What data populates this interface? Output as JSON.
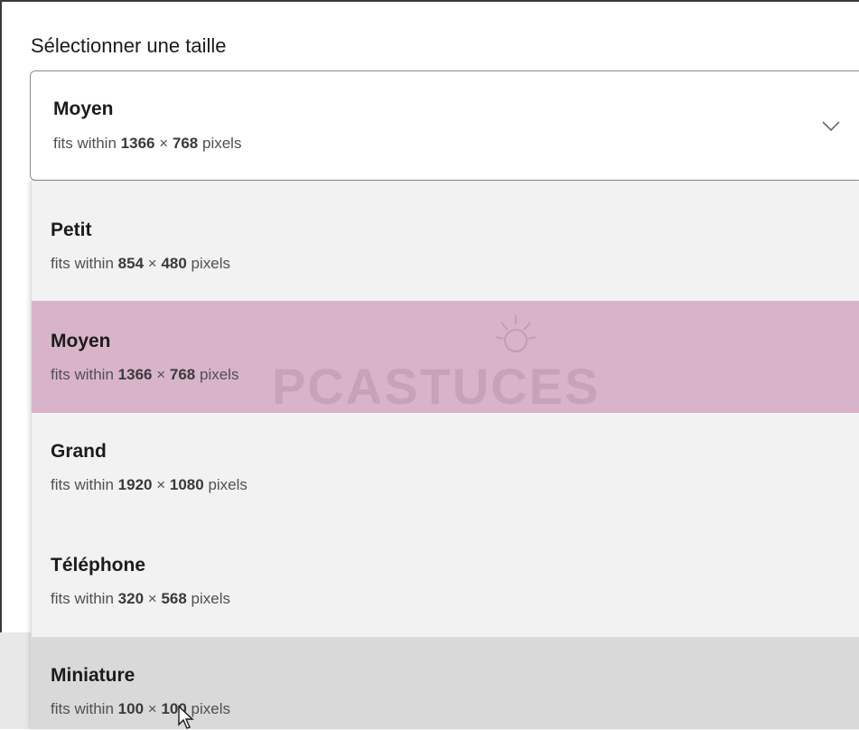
{
  "header": {
    "label": "Sélectionner une taille"
  },
  "select": {
    "selected_title": "Moyen",
    "selected_sub_prefix": "fits within",
    "selected_width": "1366",
    "selected_times": "×",
    "selected_height": "768",
    "selected_sub_suffix": "pixels"
  },
  "options": [
    {
      "title": "Petit",
      "prefix": "fits within",
      "width": "854",
      "times": "×",
      "height": "480",
      "suffix": "pixels"
    },
    {
      "title": "Moyen",
      "prefix": "fits within",
      "width": "1366",
      "times": "×",
      "height": "768",
      "suffix": "pixels"
    },
    {
      "title": "Grand",
      "prefix": "fits within",
      "width": "1920",
      "times": "×",
      "height": "1080",
      "suffix": "pixels"
    },
    {
      "title": "Téléphone",
      "prefix": "fits within",
      "width": "320",
      "times": "×",
      "height": "568",
      "suffix": "pixels"
    },
    {
      "title": "Miniature",
      "prefix": "fits within",
      "width": "100",
      "times": "×",
      "height": "100",
      "suffix": "pixels"
    }
  ],
  "colors": {
    "selected_highlight": "#d8b4cb",
    "hover_highlight": "#d9d9d9",
    "dropdown_bg": "#f2f2f2"
  },
  "watermark": {
    "text": "PCASTUCES"
  },
  "icons": {
    "chevron": "chevron-down-icon",
    "cursor": "mouse-pointer-icon",
    "watermark_logo": "sun-logo-icon"
  }
}
